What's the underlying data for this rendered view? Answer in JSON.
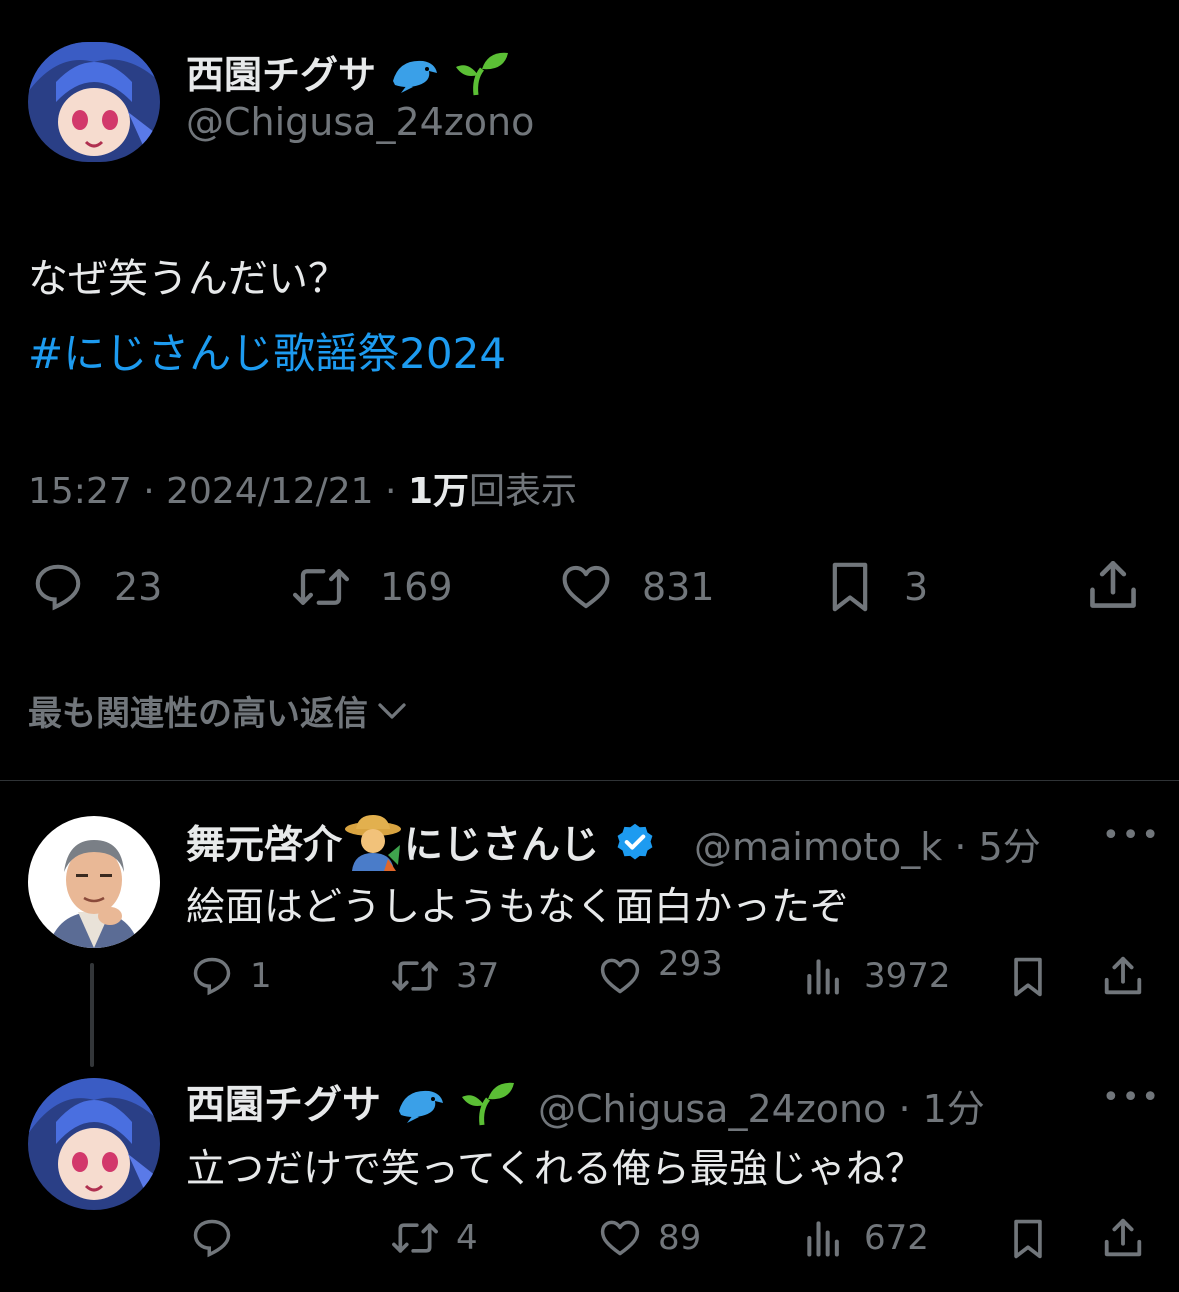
{
  "main_tweet": {
    "display_name": "西園チグサ",
    "emojis": [
      "dolphin-emoji",
      "seedling-emoji"
    ],
    "handle": "@Chigusa_24zono",
    "text": "なぜ笑うんだい？",
    "hashtag": "#にじさんじ歌謡祭2024",
    "time": "15:27",
    "date": "2024/12/21",
    "views_number": "1万",
    "views_label": "回表示",
    "replies": "23",
    "retweets": "169",
    "likes": "831",
    "bookmarks": "3"
  },
  "sort_label": "最も関連性の高い返信",
  "replies": [
    {
      "display_name": "舞元啓介",
      "emoji": "farmer-emoji",
      "affiliation": "にじさんじ",
      "verified": true,
      "handle": "@maimoto_k",
      "time_ago": "5分",
      "text": "絵面はどうしようもなく面白かったぞ",
      "replies": "1",
      "retweets": "37",
      "likes": "293",
      "views": "3972"
    },
    {
      "display_name": "西園チグサ",
      "emojis": [
        "dolphin-emoji",
        "seedling-emoji"
      ],
      "handle": "@Chigusa_24zono",
      "time_ago": "1分",
      "text": "立つだけで笑ってくれる俺ら最強じゃね？",
      "replies": "",
      "retweets": "4",
      "likes": "89",
      "views": "672"
    }
  ],
  "colors": {
    "background": "#000000",
    "text": "#e7e9ea",
    "muted": "#71767b",
    "link": "#1d9bf0",
    "verified": "#1d9bf0"
  }
}
